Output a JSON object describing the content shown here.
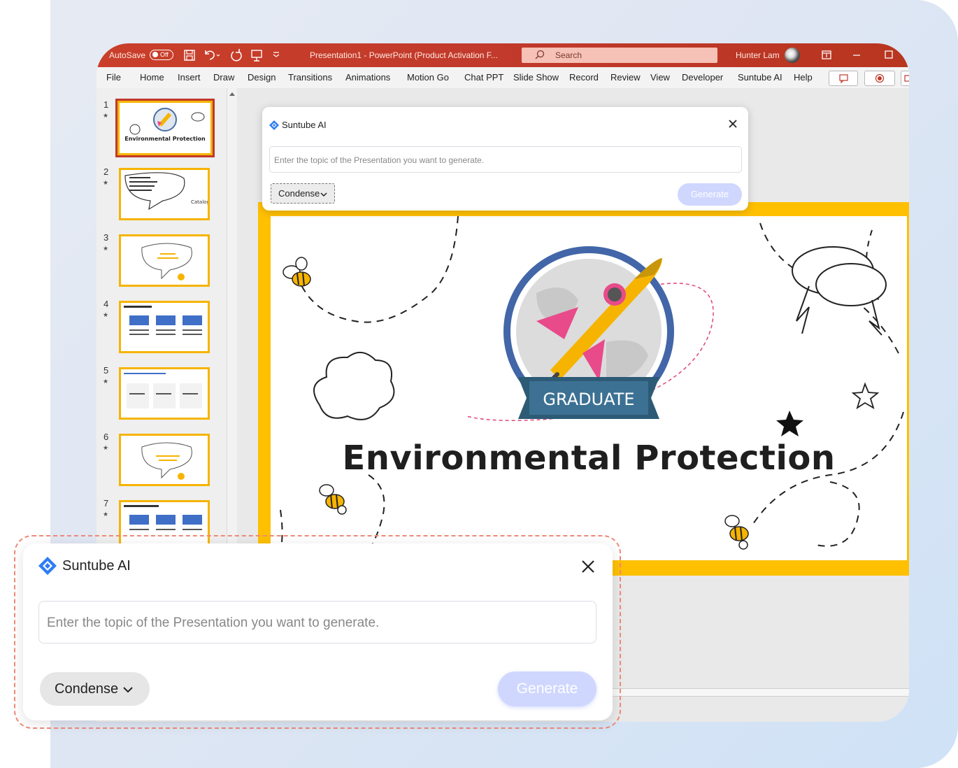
{
  "titlebar": {
    "autosave_label": "AutoSave",
    "autosave_state": "Off",
    "document_title": "Presentation1  -  PowerPoint (Product Activation F...",
    "search_placeholder": "Search",
    "user_name": "Hunter Lam"
  },
  "ribbon": {
    "tabs": [
      "File",
      "Home",
      "Insert",
      "Draw",
      "Design",
      "Transitions",
      "Animations",
      "Motion Go",
      "Chat PPT",
      "Slide Show",
      "Record",
      "Review",
      "View",
      "Developer",
      "Suntube AI",
      "Help"
    ]
  },
  "thumbnails": [
    {
      "number": "1",
      "star": "★",
      "caption": "Environmental Protection"
    },
    {
      "number": "2",
      "star": "★",
      "caption": "Catalog content"
    },
    {
      "number": "3",
      "star": "★",
      "caption": ""
    },
    {
      "number": "4",
      "star": "★",
      "caption": ""
    },
    {
      "number": "5",
      "star": "★",
      "caption": ""
    },
    {
      "number": "6",
      "star": "★",
      "caption": ""
    },
    {
      "number": "7",
      "star": "★",
      "caption": ""
    }
  ],
  "slide": {
    "badge_text": "GRADUATE",
    "title": "Environmental Protection"
  },
  "dialog_small": {
    "title": "Suntube AI",
    "placeholder": "Enter the topic of the Presentation you want to generate.",
    "dropdown": "Condense",
    "generate": "Generate"
  },
  "dialog_large": {
    "title": "Suntube AI",
    "placeholder": "Enter the topic of the Presentation you want to generate.",
    "dropdown": "Condense",
    "generate": "Generate"
  },
  "colors": {
    "titlebar": "#c0392b",
    "slide_border": "#ffc000",
    "generate_disabled": "#cfd7ff",
    "dashed_outline": "#ef8a79"
  }
}
